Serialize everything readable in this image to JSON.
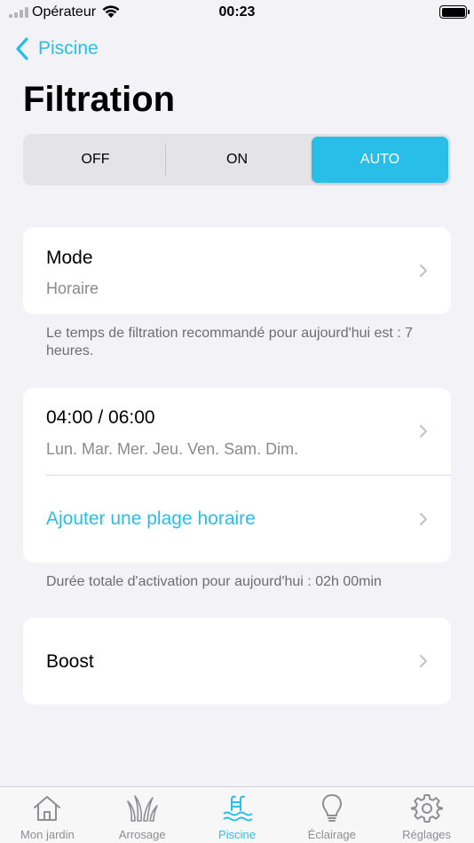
{
  "status_bar": {
    "carrier": "Opérateur",
    "time": "00:23"
  },
  "nav": {
    "back_label": "Piscine"
  },
  "page": {
    "title": "Filtration"
  },
  "segmented": {
    "off": "OFF",
    "on": "ON",
    "auto": "AUTO",
    "selected": "AUTO"
  },
  "mode_card": {
    "title": "Mode",
    "value": "Horaire"
  },
  "mode_note": "Le temps de filtration recommandé pour aujourd'hui est : 7 heures.",
  "schedule_card": {
    "slot_time": "04:00 / 06:00",
    "slot_days": "Lun. Mar. Mer. Jeu. Ven. Sam. Dim.",
    "add_label": "Ajouter une plage horaire"
  },
  "schedule_note": "Durée totale d'activation pour aujourd'hui : 02h 00min",
  "boost_card": {
    "title": "Boost"
  },
  "tabs": [
    {
      "label": "Mon jardin",
      "icon": "house-icon"
    },
    {
      "label": "Arrosage",
      "icon": "grass-icon"
    },
    {
      "label": "Piscine",
      "icon": "pool-icon"
    },
    {
      "label": "Éclairage",
      "icon": "lightbulb-icon"
    },
    {
      "label": "Réglages",
      "icon": "gear-icon"
    }
  ],
  "colors": {
    "accent": "#29BEE8",
    "background": "#F2F2F7",
    "inactive": "#8E8E93"
  }
}
